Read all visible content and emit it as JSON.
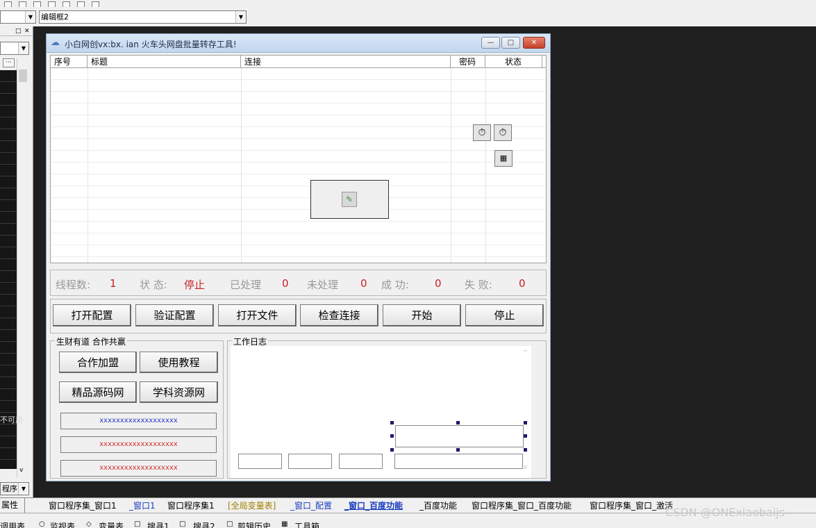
{
  "ide": {
    "combo_left_value": "",
    "combo_right_value": "编辑框2",
    "left_panel_label": "程序",
    "left_panel_cut_text": "不可用",
    "props_tab": "属性"
  },
  "window": {
    "title": "小白网创vx:bx.        ian 火车头网盘批量转存工具!",
    "min_glyph": "—",
    "max_glyph": "□",
    "close_glyph": "✕"
  },
  "listview": {
    "columns": [
      "序号",
      "标题",
      "连接",
      "密码",
      "状态"
    ]
  },
  "status": {
    "threads_label": "线程数:",
    "threads_value": "1",
    "state_label": "状 态:",
    "state_value": "停止",
    "processed_label": "已处理",
    "processed_value": "0",
    "unprocessed_label": "未处理",
    "unprocessed_value": "0",
    "success_label": "成 功:",
    "success_value": "0",
    "fail_label": "失 败:",
    "fail_value": "0"
  },
  "buttons": {
    "open_config": "打开配置",
    "verify_config": "验证配置",
    "open_file": "打开文件",
    "check_link": "检查连接",
    "start": "开始",
    "stop": "停止"
  },
  "coop_group": {
    "title": "生财有道 合作共赢",
    "join": "合作加盟",
    "tutorial": "使用教程",
    "source_site": "精品源码网",
    "resource_site": "学科资源网",
    "bar1": "xxxxxxxxxxxxxxxxxxx",
    "bar2": "xxxxxxxxxxxxxxxxxxx",
    "bar3": "xxxxxxxxxxxxxxxxxxx"
  },
  "log_group": {
    "title": "工作日志"
  },
  "tabs": [
    "窗口程序集_窗口1",
    "_窗口1",
    "窗口程序集1",
    "[全局变量表]",
    "_窗口_配置",
    "_窗口_百度功能",
    "_百度功能",
    "窗口程序集_窗口_百度功能",
    "窗口程序集_窗口_激活"
  ],
  "bottombar": [
    "调用表",
    "监视表",
    "变量表",
    "搜寻1",
    "搜寻2",
    "剪辑历史",
    "工具箱"
  ],
  "watermark": "CSDN @ONExiaobaijs",
  "colors": {
    "red_value": "#c82020",
    "blue_bar_text": "#2a3cc8",
    "red_bar_text": "#d03030"
  }
}
